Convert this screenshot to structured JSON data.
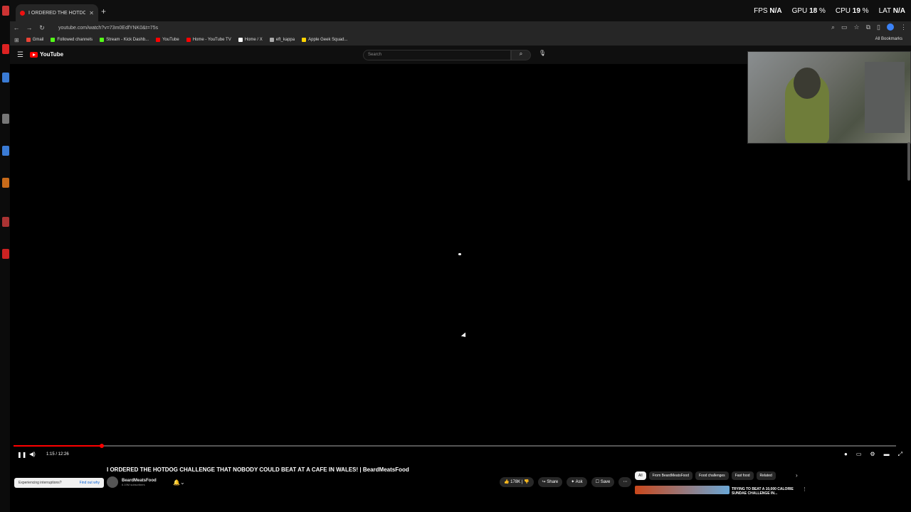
{
  "browser": {
    "tab_title": "I ORDERED THE HOTDOG CHA",
    "url": "youtube.com/watch?v=73m0EdfYNK0&t=75s",
    "bookmarks": [
      {
        "label": "Gmail",
        "color": "#ea4335"
      },
      {
        "label": "Followed channels",
        "color": "#53fc18"
      },
      {
        "label": "Stream - Kick Dashb...",
        "color": "#53fc18"
      },
      {
        "label": "YouTube",
        "color": "#ff0000"
      },
      {
        "label": "Home - YouTube TV",
        "color": "#ff0000"
      },
      {
        "label": "Home / X",
        "color": "#ffffff"
      },
      {
        "label": "eft_kappa",
        "color": "#aaaaaa"
      },
      {
        "label": "Apple Geek Squad...",
        "color": "#ffd400"
      }
    ],
    "all_bookmarks": "All Bookmarks"
  },
  "overlay": {
    "fps_label": "FPS",
    "fps_value": "N/A",
    "gpu_label": "GPU",
    "gpu_value": "18",
    "cpu_label": "CPU",
    "cpu_value": "19",
    "lat_label": "LAT",
    "lat_value": "N/A"
  },
  "youtube": {
    "logo_text": "YouTube",
    "search_placeholder": "Search",
    "time": "1:15 / 12:26",
    "progress": 0.1,
    "video_title": "I ORDERED THE HOTDOG CHALLENGE THAT NOBODY COULD BEAT AT A CAFE IN WALES! | BeardMeatsFood",
    "channel_name": "BeardMeatsFood",
    "subscribers": "6.19M subscribers",
    "actions": {
      "likes": "178K",
      "share": "Share",
      "ask": "Ask",
      "save": "Save"
    },
    "chips": [
      "All",
      "From BeardMeatsFood",
      "Food challenges",
      "Fast food",
      "Related"
    ],
    "recommended_title": "TRYING TO BEAT A 10,000 CALORIE SUNDAE CHALLENGE IN...",
    "toast_text": "Experiencing interruptions?",
    "toast_link": "Find out why"
  }
}
